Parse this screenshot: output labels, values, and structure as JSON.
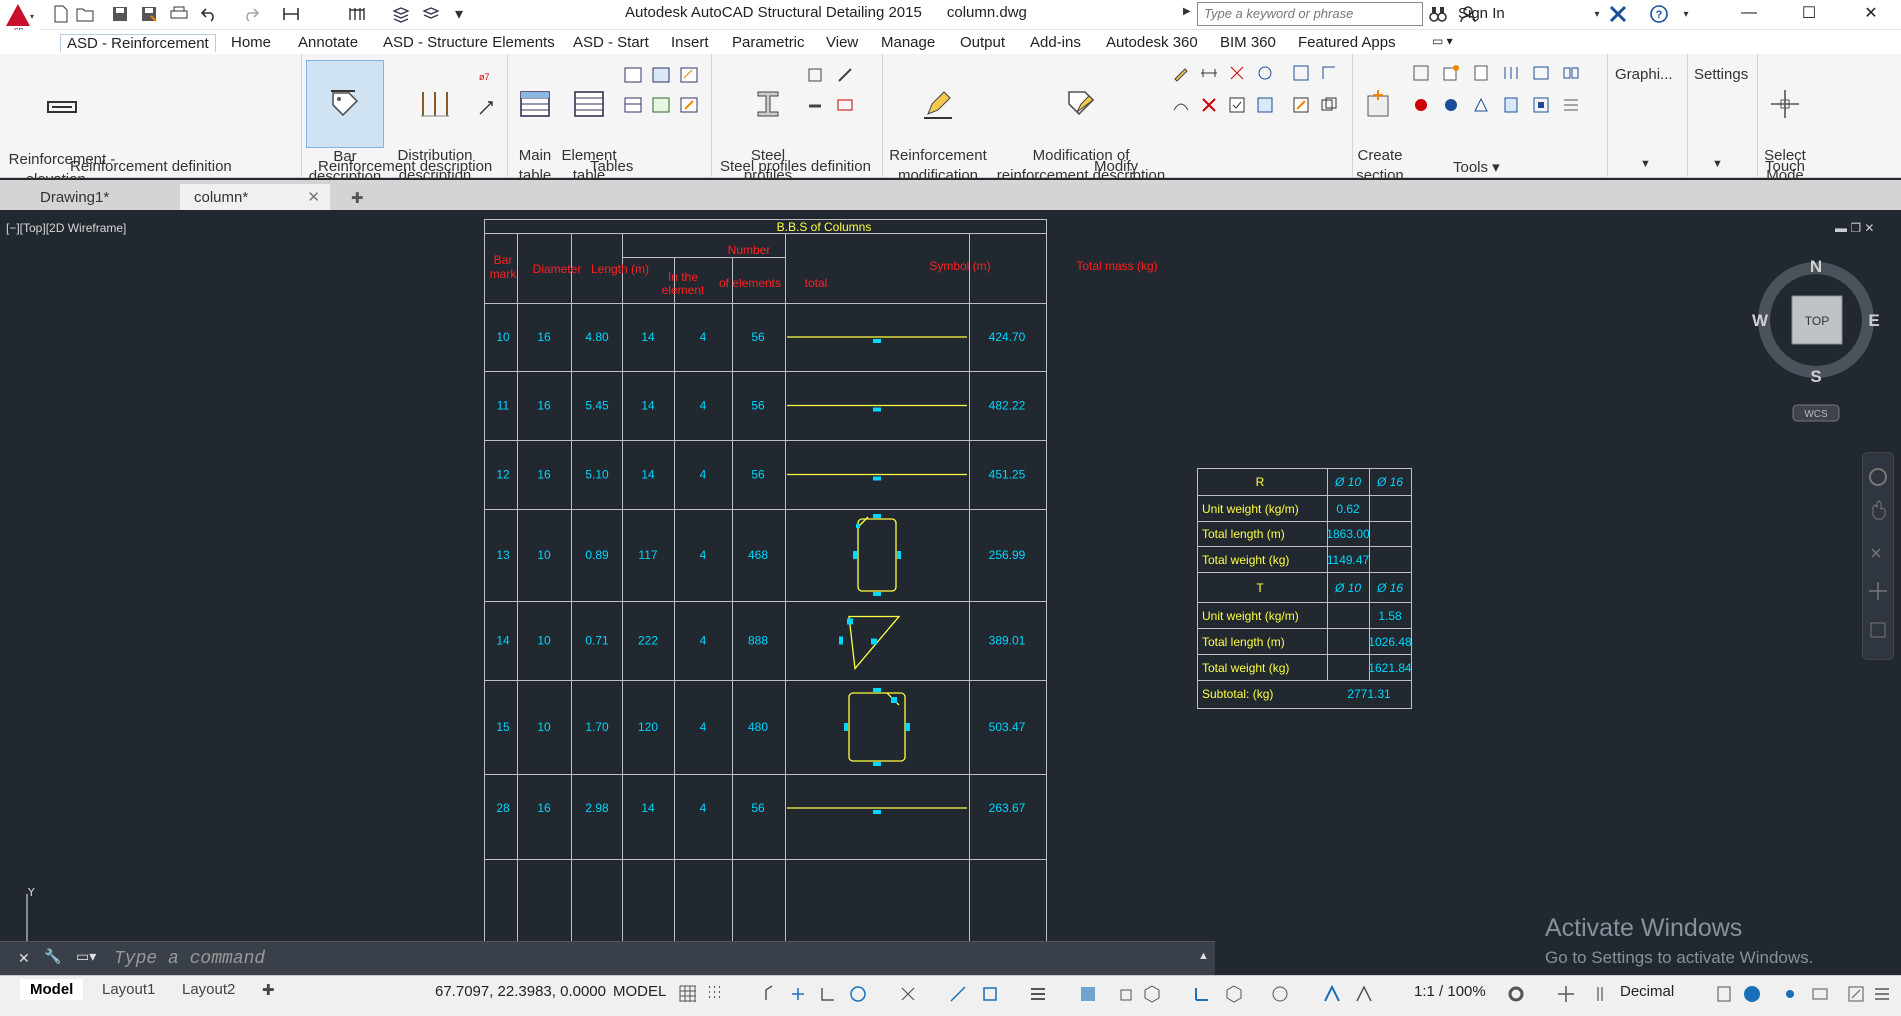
{
  "app": {
    "title": "Autodesk AutoCAD Structural Detailing 2015",
    "filename": "column.dwg",
    "logo_text": "SD",
    "search_placeholder": "Type a keyword or phrase",
    "sign_in": "Sign In"
  },
  "ribbon_tabs": [
    "ASD - Reinforcement",
    "Home",
    "Annotate",
    "ASD - Structure Elements",
    "ASD - Start",
    "Insert",
    "Parametric",
    "View",
    "Manage",
    "Output",
    "Add-ins",
    "Autodesk 360",
    "BIM 360",
    "Featured Apps"
  ],
  "ribbon": {
    "reinf_elevation": "Reinforcement -\nelevation...",
    "bar_description": "Bar\ndescription",
    "distribution_description": "Distribution\ndescription",
    "main_table": "Main\ntable",
    "element_table": "Element\ntable",
    "steel_profiles": "Steel\nprofiles",
    "reinf_modification": "Reinforcement\nmodification",
    "mod_reinf_description": "Modification of\nreinforcement description",
    "create_section": "Create\nsection",
    "graphics": "Graphi...",
    "settings": "Settings",
    "select_mode": "Select\nMode",
    "panels": {
      "reinf_def": "Reinforcement definition",
      "reinf_desc": "Reinforcement description",
      "tables": "Tables",
      "steel_def": "Steel profiles definition",
      "modify": "Modify",
      "tools": "Tools ▾",
      "touch": "Touch"
    }
  },
  "doc_tabs": [
    "Drawing1*",
    "column*"
  ],
  "view_label": "[−][Top][2D Wireframe]",
  "bbs": {
    "title": "B.B.S of Columns",
    "headers": {
      "bar_mark": [
        "Bar",
        "mark"
      ],
      "diameter": "Diameter",
      "length": "Length (m)",
      "number": "Number",
      "in_element": [
        "In the",
        "element"
      ],
      "of_elements": "of elements",
      "total": "total",
      "symbol": "Symbol (m)",
      "total_mass": "Total mass (kg)"
    },
    "rows": [
      {
        "mark": "10",
        "dia": "16",
        "len": "4.80",
        "in_el": "14",
        "of_el": "4",
        "total": "56",
        "mass": "424.70",
        "shape": "straight"
      },
      {
        "mark": "11",
        "dia": "16",
        "len": "5.45",
        "in_el": "14",
        "of_el": "4",
        "total": "56",
        "mass": "482.22",
        "shape": "straight"
      },
      {
        "mark": "12",
        "dia": "16",
        "len": "5.10",
        "in_el": "14",
        "of_el": "4",
        "total": "56",
        "mass": "451.25",
        "shape": "straight"
      },
      {
        "mark": "13",
        "dia": "10",
        "len": "0.89",
        "in_el": "117",
        "of_el": "4",
        "total": "468",
        "mass": "256.99",
        "shape": "stirrup-tall"
      },
      {
        "mark": "14",
        "dia": "10",
        "len": "0.71",
        "in_el": "222",
        "of_el": "4",
        "total": "888",
        "mass": "389.01",
        "shape": "stirrup-triangle"
      },
      {
        "mark": "15",
        "dia": "10",
        "len": "1.70",
        "in_el": "120",
        "of_el": "4",
        "total": "480",
        "mass": "503.47",
        "shape": "stirrup-square"
      },
      {
        "mark": "28",
        "dia": "16",
        "len": "2.98",
        "in_el": "14",
        "of_el": "4",
        "total": "56",
        "mass": "263.67",
        "shape": "straight"
      }
    ]
  },
  "summary": {
    "r_label": "R",
    "t_label": "T",
    "d10": "Ø 10",
    "d16": "Ø 16",
    "r_rows": [
      {
        "label": "Unit weight (kg/m)",
        "c10": "0.62",
        "c16": ""
      },
      {
        "label": "Total length (m)",
        "c10": "1863.00",
        "c16": ""
      },
      {
        "label": "Total weight (kg)",
        "c10": "1149.47",
        "c16": ""
      }
    ],
    "t_rows": [
      {
        "label": "Unit weight (kg/m)",
        "c10": "",
        "c16": "1.58"
      },
      {
        "label": "Total length (m)",
        "c10": "",
        "c16": "1026.48"
      },
      {
        "label": "Total weight (kg)",
        "c10": "",
        "c16": "1621.84"
      }
    ],
    "subtotal_label": "Subtotal: (kg)",
    "subtotal_value": "2771.31"
  },
  "viewcube": {
    "n": "N",
    "s": "S",
    "e": "E",
    "w": "W",
    "top": "TOP",
    "wcs": "WCS"
  },
  "ucs_y": "Y",
  "cmd_placeholder": "Type a command",
  "layout_tabs": [
    "Model",
    "Layout1",
    "Layout2"
  ],
  "status": {
    "coords": "67.7097, 22.3983, 0.0000",
    "mode": "MODEL",
    "scale": "1:1 / 100%",
    "units": "Decimal"
  },
  "watermark": {
    "line1": "Activate Windows",
    "line2": "Go to Settings to activate Windows."
  }
}
